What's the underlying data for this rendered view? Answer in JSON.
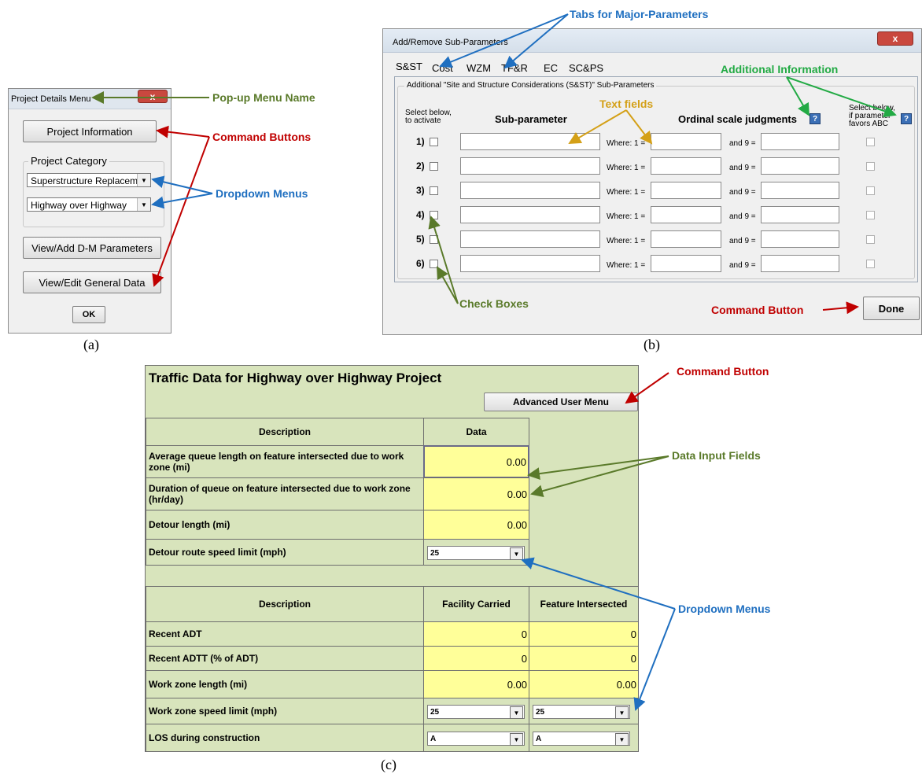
{
  "panel_a": {
    "window_title": "Project Details Menu",
    "close_label": "x",
    "project_information_label": "Project Information",
    "category_legend": "Project Category",
    "category_value_1": "Superstructure Replaceme",
    "category_value_2": "Highway over Highway",
    "view_add_dm_label": "View/Add D-M Parameters",
    "view_edit_general_label": "View/Edit General Data",
    "ok_label": "OK",
    "caption": "(a)"
  },
  "panel_b": {
    "window_title": "Add/Remove Sub-Parameters",
    "close_label": "x",
    "tabs": [
      "S&ST",
      "Cost",
      "WZM",
      "TF&R",
      "EC",
      "SC&PS"
    ],
    "group_legend": "Additional \"Site and Structure Considerations (S&ST)\" Sub-Parameters",
    "select_below_label": "Select below, to activate",
    "sub_parameter_header": "Sub-parameter",
    "ordinal_header": "Ordinal scale judgments",
    "favors_abc_label": "Select below, if parameter favors ABC",
    "help_icon_label": "?",
    "where_label": "Where: 1 =",
    "and9_label": "and 9 =",
    "rows": [
      "1)",
      "2)",
      "3)",
      "4)",
      "5)",
      "6)"
    ],
    "done_label": "Done",
    "caption": "(b)"
  },
  "panel_c": {
    "title": "Traffic Data for Highway over Highway Project",
    "advanced_button_label": "Advanced User Menu",
    "table1_headers": [
      "Description",
      "Data"
    ],
    "table1_rows": [
      {
        "label": "Average queue length on feature intersected due to work zone (mi)",
        "value": "0.00"
      },
      {
        "label": "Duration of queue on feature intersected due to work zone (hr/day)",
        "value": "0.00"
      },
      {
        "label": "Detour length (mi)",
        "value": "0.00"
      },
      {
        "label": "Detour route speed limit (mph)",
        "value": "25"
      }
    ],
    "table2_headers": [
      "Description",
      "Facility Carried",
      "Feature Intersected"
    ],
    "table2_rows": [
      {
        "label": "Recent ADT",
        "carried": "0",
        "intersected": "0"
      },
      {
        "label": "Recent ADTT (% of ADT)",
        "carried": "0",
        "intersected": "0"
      },
      {
        "label": "Work zone length (mi)",
        "carried": "0.00",
        "intersected": "0.00"
      },
      {
        "label": "Work zone speed limit (mph)",
        "carried": "25",
        "intersected": "25"
      },
      {
        "label": "LOS during construction",
        "carried": "A",
        "intersected": "A"
      }
    ],
    "caption": "(c)"
  },
  "annotations": {
    "popup_menu_name": "Pop-up Menu Name",
    "command_buttons": "Command Buttons",
    "dropdown_menus_a": "Dropdown Menus",
    "tabs_major": "Tabs for Major-Parameters",
    "additional_information": "Additional Information",
    "text_fields": "Text fields",
    "check_boxes": "Check Boxes",
    "command_button_b": "Command Button",
    "command_button_c": "Command Button",
    "data_input_fields": "Data Input Fields",
    "dropdown_menus_c": "Dropdown Menus"
  },
  "colors": {
    "annotation_green": "#5a7a2a",
    "annotation_red": "#c00000",
    "annotation_blue": "#1f6fc0",
    "annotation_bright_green": "#22aa44",
    "annotation_gold": "#d4a017",
    "sheet_background": "#d8e4bc",
    "input_yellow": "#ffff99"
  }
}
